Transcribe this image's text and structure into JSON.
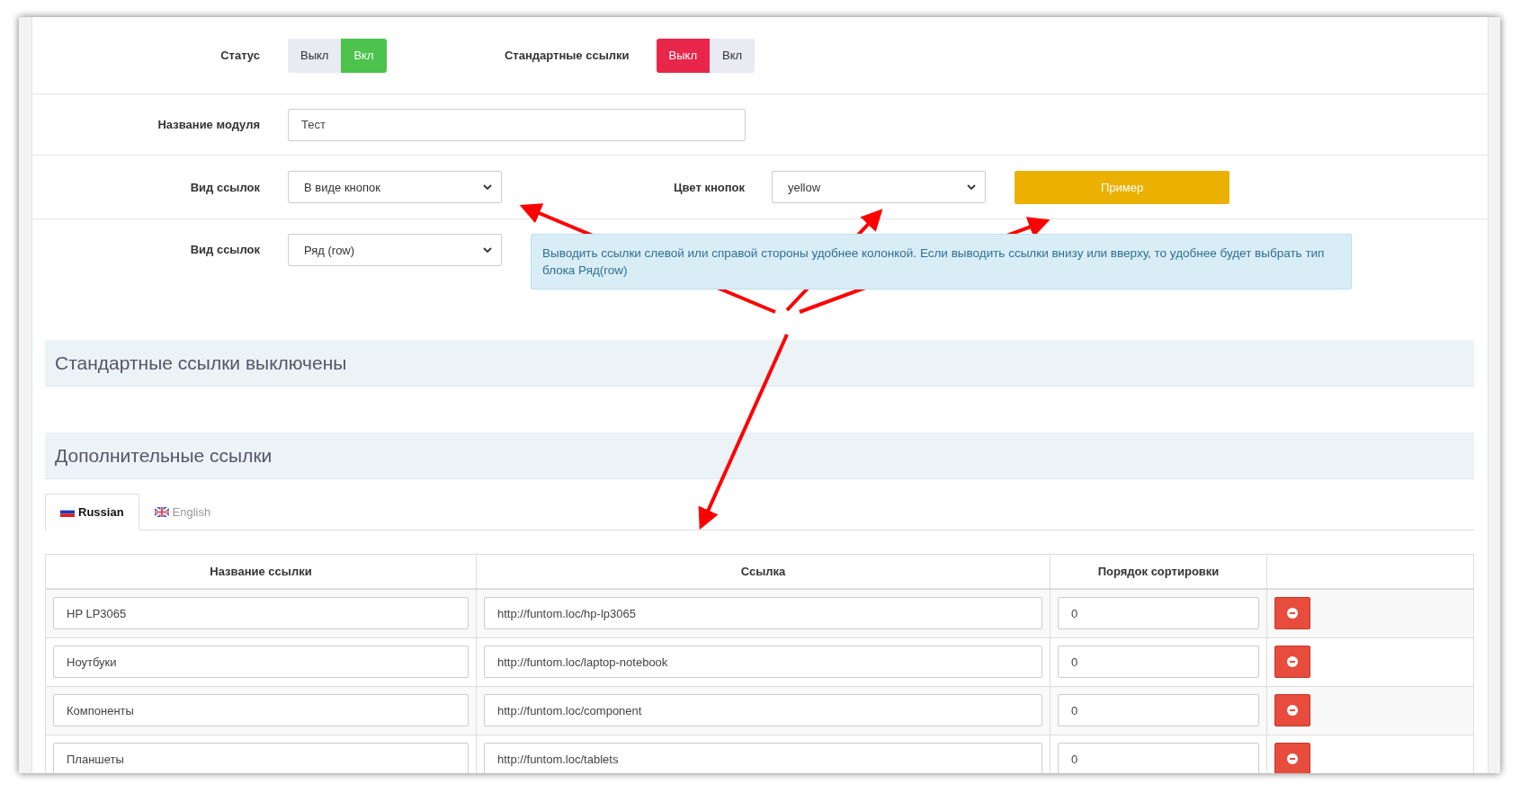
{
  "status": {
    "label": "Статус",
    "options": [
      {
        "label": "Выкл",
        "selected": false
      },
      {
        "label": "Вкл",
        "selected": true
      }
    ]
  },
  "standard_links": {
    "label": "Стандартные ссылки",
    "options": [
      {
        "label": "Выкл",
        "selected": true
      },
      {
        "label": "Вкл",
        "selected": false
      }
    ]
  },
  "module_name": {
    "label": "Название модуля",
    "value": "Тест"
  },
  "link_view": {
    "label": "Вид ссылок",
    "value": "В виде кнопок"
  },
  "button_color": {
    "label": "Цвет кнопок",
    "value": "yellow"
  },
  "example_button": "Пример",
  "link_layout": {
    "label": "Вид ссылок",
    "value": "Ряд (row)"
  },
  "info_text": "Выводить ссылки слевой или справой стороны удобнее колонкой. Если выводить ссылки внизу или вверху, то удобнее будет выбрать тип блока Ряд(row)",
  "sections": [
    "Стандартные ссылки выключены",
    "Дополнительные ссылки"
  ],
  "tabs": [
    {
      "label": "Russian",
      "kind": "ru",
      "selected": true
    },
    {
      "label": "English",
      "kind": "gb",
      "selected": false
    }
  ],
  "table": {
    "columns": [
      "Название ссылки",
      "Ссылка",
      "Порядок сортировки"
    ],
    "rows": [
      {
        "name": "HP LP3065",
        "url": "http://funtom.loc/hp-lp3065",
        "sort": "0"
      },
      {
        "name": "Ноутбуки",
        "url": "http://funtom.loc/laptop-notebook",
        "sort": "0"
      },
      {
        "name": "Компоненты",
        "url": "http://funtom.loc/component",
        "sort": "0"
      },
      {
        "name": "Планшеты",
        "url": "http://funtom.loc/tablets",
        "sort": "0"
      }
    ]
  }
}
